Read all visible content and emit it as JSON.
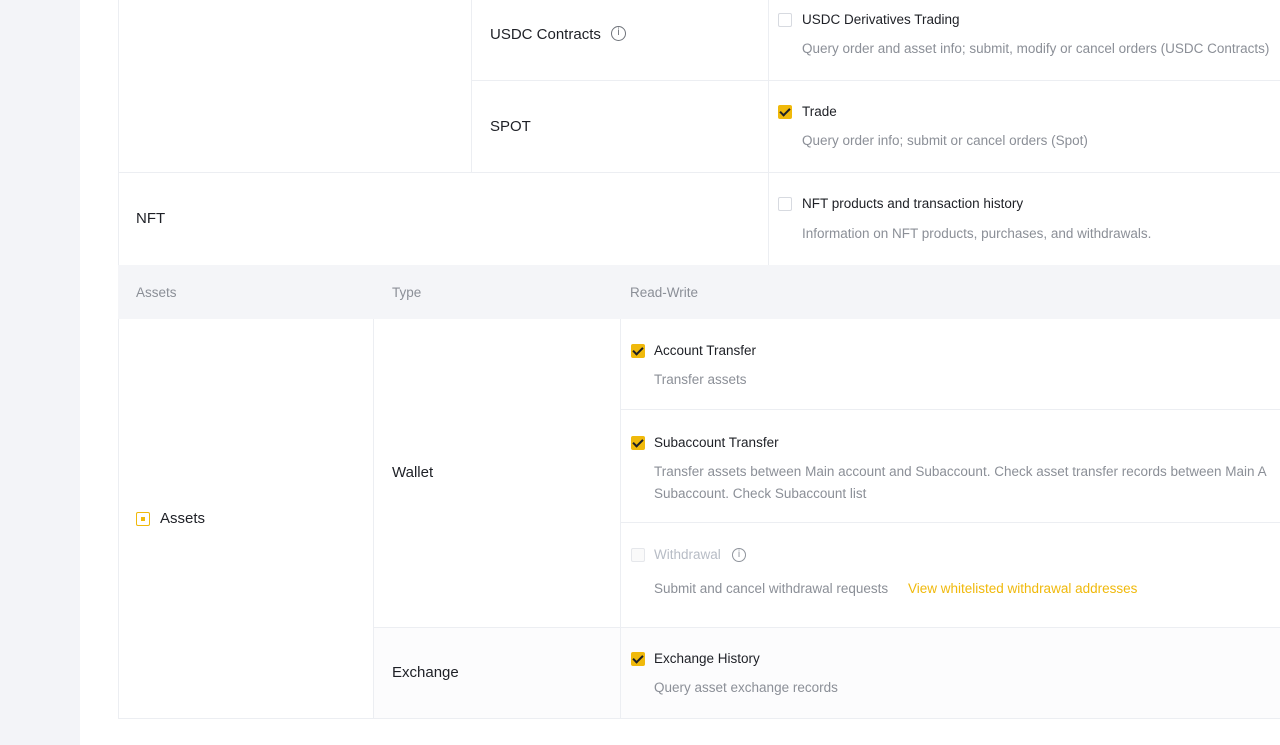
{
  "upper": {
    "rows": [
      {
        "label": "USDC Contracts",
        "permission": {
          "title": "USDC Derivatives Trading",
          "description": "Query order and asset info; submit, modify or cancel orders (USDC Contracts)",
          "checked": false
        }
      },
      {
        "label": "SPOT",
        "permission": {
          "title": "Trade",
          "description": "Query order info; submit or cancel orders (Spot)",
          "checked": true
        }
      },
      {
        "label": "NFT",
        "permission": {
          "title": "NFT products and transaction history",
          "description": "Information on NFT products, purchases, and withdrawals.",
          "checked": false
        }
      }
    ]
  },
  "assets_table": {
    "headers": [
      "Assets",
      "Type",
      "Read-Write"
    ],
    "group": {
      "label": "Assets",
      "state": "partial"
    },
    "wallet": {
      "label": "Wallet",
      "permissions": [
        {
          "title": "Account Transfer",
          "description": "Transfer assets",
          "checked": true
        },
        {
          "title": "Subaccount Transfer",
          "description_line1": "Transfer assets between Main account and Subaccount. Check asset transfer records between Main A",
          "description_line2": "Subaccount. Check Subaccount list",
          "checked": true
        },
        {
          "title": "Withdrawal",
          "description": "Submit and cancel withdrawal requests",
          "link": "View whitelisted withdrawal addresses",
          "checked": false,
          "disabled": true
        }
      ]
    },
    "exchange": {
      "label": "Exchange",
      "permissions": [
        {
          "title": "Exchange History",
          "description": "Query asset exchange records",
          "checked": true
        }
      ]
    }
  },
  "icons": {
    "info": "info-icon",
    "check": "check-icon"
  },
  "colors": {
    "accent": "#f0b90b",
    "page_bg": "#f4f5f8",
    "text": "#1e2026",
    "muted": "#8b8f97"
  }
}
